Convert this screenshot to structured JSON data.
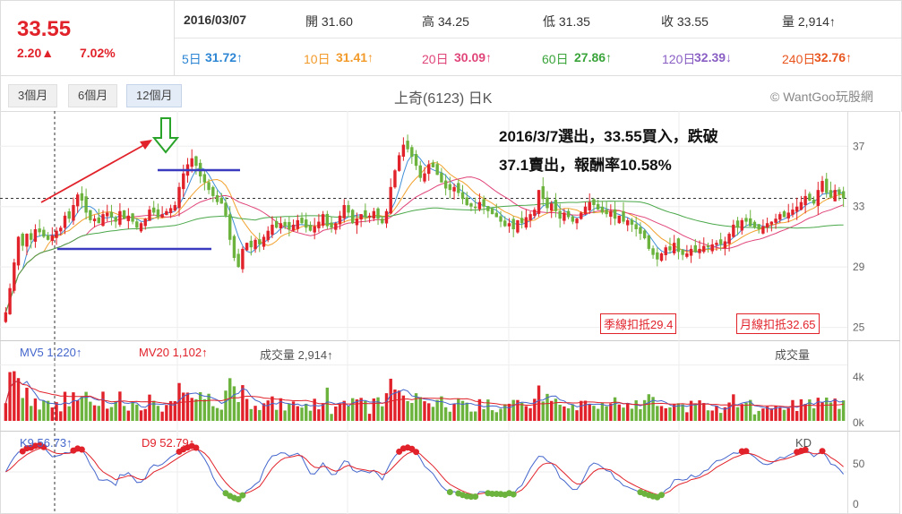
{
  "quote": {
    "price": "33.55",
    "change": "2.20▲",
    "change_pct": "7.02%",
    "date": "2016/03/07",
    "open": "開 31.60",
    "high": "高 34.25",
    "low": "低 31.35",
    "close": "收 33.55",
    "volume": "量 2,914↑"
  },
  "ma_labels": [
    {
      "label": "5日",
      "value": "31.72↑",
      "color": "#2d86d4"
    },
    {
      "label": "10日",
      "value": "31.41↑",
      "color": "#f29b2b"
    },
    {
      "label": "20日",
      "value": "30.09↑",
      "color": "#e0457a"
    },
    {
      "label": "60日",
      "value": "27.86↑",
      "color": "#3aa43a"
    },
    {
      "label": "120日",
      "value": "32.39↓",
      "color": "#8a5fc4"
    },
    {
      "label": "240日",
      "value": "32.76↑",
      "color": "#e8551e"
    }
  ],
  "tabs": [
    "3個月",
    "6個月",
    "12個月"
  ],
  "chart_title": "上奇(6123) 日K",
  "copyright": "© WantGoo玩股網",
  "annotation": {
    "line1": "2016/3/7選出，33.55買入，跌破",
    "line2": "37.1賣出，報酬率10.58%"
  },
  "tags": {
    "quarterly": "季線扣抵29.4",
    "monthly": "月線扣抵32.65"
  },
  "volume_panel": {
    "mv5": "MV5 1,220↑",
    "mv20": "MV20 1,102↑",
    "vol": "成交量 2,914↑",
    "title": "成交量",
    "yticks": [
      "4k",
      "0k"
    ]
  },
  "kd_panel": {
    "k": "K9 56.73↑",
    "d": "D9 52.79↑",
    "title": "KD",
    "yticks": [
      "50",
      "0"
    ]
  },
  "chart_data": {
    "type": "candlestick",
    "price_yticks": [
      25,
      29,
      33,
      37
    ],
    "ylim": [
      24.5,
      38.5
    ],
    "reference_line": 33.55,
    "closes": [
      26.0,
      27.6,
      29.3,
      31.0,
      30.4,
      31.2,
      30.8,
      31.5,
      31.3,
      31.0,
      30.8,
      31.1,
      31.4,
      31.6,
      32.4,
      32.2,
      33.1,
      33.8,
      33.4,
      32.6,
      32.1,
      32.2,
      31.9,
      32.5,
      32.6,
      32.3,
      32.0,
      32.7,
      32.2,
      32.4,
      32.0,
      31.6,
      31.9,
      32.2,
      32.8,
      32.6,
      32.3,
      32.5,
      32.7,
      32.9,
      33.1,
      34.3,
      35.2,
      35.8,
      36.2,
      35.7,
      35.0,
      34.6,
      34.1,
      33.7,
      33.3,
      33.2,
      32.4,
      30.8,
      29.6,
      29.0,
      30.2,
      30.6,
      30.3,
      30.8,
      30.5,
      31.0,
      31.4,
      31.8,
      31.6,
      31.9,
      31.7,
      31.5,
      31.8,
      32.1,
      31.9,
      31.6,
      31.4,
      31.7,
      32.0,
      32.5,
      31.7,
      31.6,
      31.9,
      32.4,
      33.1,
      32.6,
      31.9,
      32.2,
      32.5,
      32.3,
      32.4,
      32.7,
      32.2,
      31.9,
      32.7,
      34.3,
      35.4,
      36.4,
      37.1,
      36.8,
      36.3,
      35.7,
      34.9,
      35.2,
      35.8,
      35.6,
      35.1,
      34.6,
      34.2,
      34.1,
      34.3,
      33.9,
      33.5,
      33.1,
      33.0,
      32.9,
      33.3,
      33.0,
      32.7,
      32.5,
      32.3,
      32.0,
      31.7,
      31.9,
      31.5,
      32.1,
      31.9,
      32.3,
      32.5,
      32.8,
      34.1,
      33.5,
      32.9,
      33.2,
      32.7,
      32.2,
      32.6,
      32.3,
      32.0,
      32.2,
      32.6,
      33.0,
      33.3,
      33.1,
      32.8,
      32.6,
      32.5,
      32.7,
      32.2,
      32.4,
      32.0,
      32.1,
      31.8,
      31.5,
      31.2,
      30.9,
      30.2,
      29.8,
      29.5,
      29.9,
      30.3,
      30.1,
      30.6,
      30.0,
      29.8,
      29.9,
      30.2,
      30.0,
      30.2,
      30.4,
      30.3,
      30.5,
      30.6,
      30.5,
      30.7,
      31.2,
      31.8,
      31.6,
      32.1,
      32.0,
      31.7,
      31.6,
      31.5,
      31.7,
      31.9,
      32.0,
      32.2,
      32.5,
      32.3,
      32.6,
      32.8,
      33.0,
      33.3,
      33.7,
      33.4,
      33.2,
      34.1,
      34.7,
      33.9,
      33.6,
      34.1,
      33.8,
      33.55
    ],
    "volume_scale_max": 5000,
    "kd_ylim": [
      0,
      100
    ]
  }
}
